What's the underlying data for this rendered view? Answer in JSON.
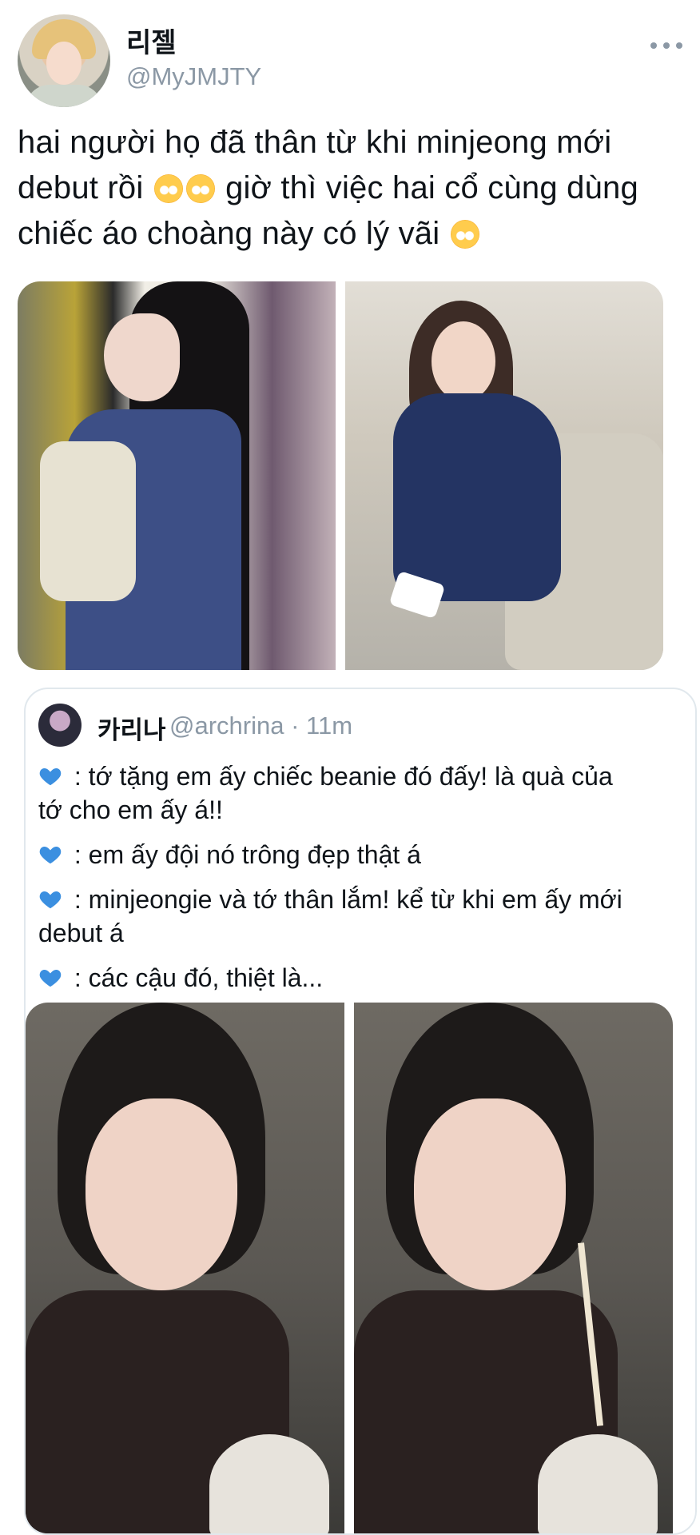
{
  "author": {
    "display_name": "리젤",
    "handle": "@MyJMJTY"
  },
  "tweet": {
    "lines": [
      [
        "hai người họ đã thân từ khi minjeong mới",
        ""
      ],
      [
        "debut rồi",
        "  giờ thì việc hai cổ cùng dùng"
      ],
      [
        "chiếc áo choàng này có lý vãi",
        ""
      ]
    ],
    "emoji": "pleading-face-emoji"
  },
  "media": {
    "count": 2
  },
  "quote": {
    "display_name": "카리나",
    "handle_time": "@archrina · 11m",
    "paragraphs": [
      [
        " : tớ tặng em ấy chiếc beanie đó đấy! là quà của",
        "tớ cho em ấy á!!"
      ],
      [
        " : em ấy đội nó trông đẹp thật á"
      ],
      [
        " : minjeongie và tớ thân lắm! kể từ khi em ấy mới",
        "debut á"
      ],
      [
        " : các cậu đó, thiệt là..."
      ]
    ],
    "emoji": "blue-heart-emoji",
    "heart_color": "#3b8fe0",
    "media_count": 2
  },
  "colors": {
    "secondary_text": "#8b98a5",
    "border": "#e1e8ed"
  }
}
